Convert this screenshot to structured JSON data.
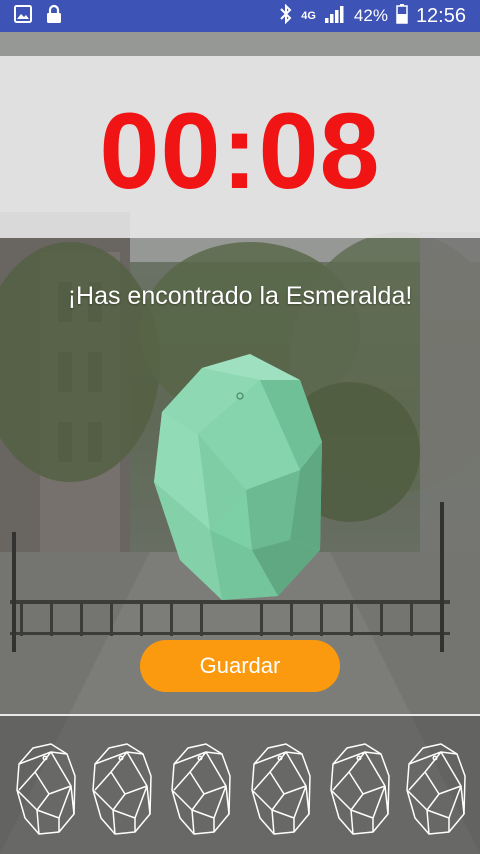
{
  "status_bar": {
    "network_label": "4G",
    "battery_percent": "42%",
    "time": "12:56",
    "icons": [
      "image-icon",
      "lock-icon",
      "bluetooth-icon",
      "signal-icon",
      "battery-icon"
    ]
  },
  "timer": {
    "value": "00:08",
    "color": "#f01414"
  },
  "message": "¡Has encontrado la Esmeralda!",
  "gem": {
    "name": "Esmeralda",
    "color": "#7dcfa6"
  },
  "save_button": {
    "label": "Guardar",
    "color": "#fb9a0e"
  },
  "collection": {
    "slots": [
      {
        "state": "empty"
      },
      {
        "state": "empty"
      },
      {
        "state": "empty"
      },
      {
        "state": "empty"
      },
      {
        "state": "empty"
      },
      {
        "state": "empty"
      }
    ]
  }
}
